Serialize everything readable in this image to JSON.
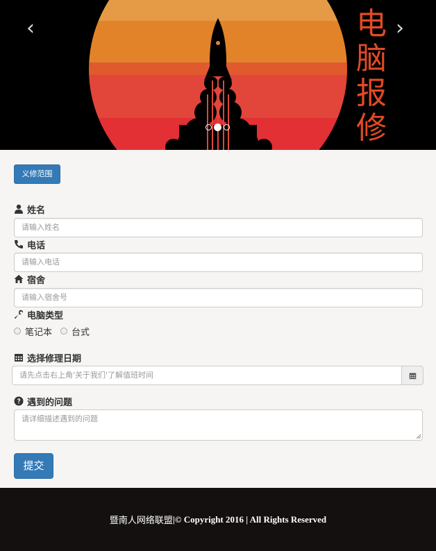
{
  "carousel": {
    "prev_icon": "chevron-left-icon",
    "next_icon": "chevron-right-icon",
    "prev_glyph": "‹",
    "next_glyph": "›",
    "title_chars": [
      "电",
      "脑",
      "报",
      "修"
    ],
    "slide_count": 3,
    "active_slide": 2,
    "colors": {
      "band1": "#e59a45",
      "band2": "#e2832a",
      "band3": "#e05a2d",
      "band4": "#e2463a",
      "band5": "#e23035",
      "title": "#e24a24"
    }
  },
  "scope_button": {
    "label": "义修范围"
  },
  "form": {
    "name": {
      "label": "姓名",
      "icon": "user-icon",
      "placeholder": "请输入姓名"
    },
    "phone": {
      "label": "电话",
      "icon": "phone-icon",
      "placeholder": "请输入电话"
    },
    "dorm": {
      "label": "宿舍",
      "icon": "home-icon",
      "placeholder": "请输入宿舍号"
    },
    "computer_type": {
      "label": "电脑类型",
      "icon": "wrench-icon",
      "options": [
        "笔记本",
        "台式"
      ]
    },
    "date": {
      "label": "选择修理日期",
      "icon": "calendar-icon",
      "placeholder": "请先点击右上角'关于我们'了解值班时间"
    },
    "problem": {
      "label": "遇到的问题",
      "icon": "question-icon",
      "placeholder": "请详细描述遇到的问题"
    },
    "submit_label": "提交"
  },
  "footer": {
    "org": "暨南人网络联盟",
    "separator": "|",
    "copyright": "© Copyright 2016 | All Rights Reserved"
  },
  "colors": {
    "primary": "#337ab7",
    "footer_bg": "#141010",
    "page_bg": "#f6f5f3"
  }
}
